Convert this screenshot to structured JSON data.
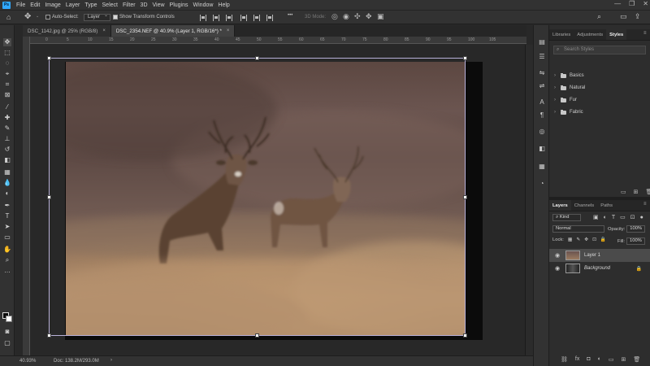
{
  "app": {
    "logo": "Ps",
    "window_controls": [
      "—",
      "❐",
      "✕"
    ]
  },
  "menu": [
    "File",
    "Edit",
    "Image",
    "Layer",
    "Type",
    "Select",
    "Filter",
    "3D",
    "View",
    "Plugins",
    "Window",
    "Help"
  ],
  "options": {
    "auto_select_label": "Auto-Select:",
    "auto_select_target": "Layer",
    "show_transform_label": "Show Transform Controls",
    "mode_3d_label": "3D Mode:",
    "more": "•••"
  },
  "tabs": [
    {
      "label": "DSC_1142.jpg @ 25% (RGB/8)",
      "close": "×"
    },
    {
      "label": "DSC_2354.NEF @ 40.9% (Layer 1, RGB/16*) *",
      "close": "×"
    }
  ],
  "ruler_ticks": [
    "0",
    "5",
    "10",
    "15",
    "20",
    "25",
    "30",
    "35",
    "40",
    "45",
    "50",
    "55",
    "60",
    "65",
    "70",
    "75",
    "80",
    "85",
    "90",
    "95",
    "100",
    "105"
  ],
  "status": {
    "zoom": "40.93%",
    "doc": "Doc: 138.2M/293.0M",
    "arrow": "›"
  },
  "styles_panel": {
    "tabs": [
      "Libraries",
      "Adjustments",
      "Styles"
    ],
    "search_placeholder": "Search Styles",
    "folders": [
      "Basics",
      "Natural",
      "Fur",
      "Fabric"
    ]
  },
  "layers_panel": {
    "tabs": [
      "Layers",
      "Channels",
      "Paths"
    ],
    "kind_label": "Kind",
    "blend_mode": "Normal",
    "opacity_label": "Opacity:",
    "opacity_value": "100%",
    "lock_label": "Lock:",
    "fill_label": "Fill:",
    "fill_value": "100%",
    "layers": [
      {
        "name": "Layer 1",
        "selected": true
      },
      {
        "name": "Background",
        "selected": false
      }
    ],
    "bottom_icons": [
      "⛓",
      "fx",
      "◘",
      "◐",
      "▭",
      "⊞",
      "🗑"
    ]
  },
  "colors": {
    "accent": "#31a8ff",
    "panel": "#2d2d2d",
    "selection": "#4b4b4b"
  }
}
